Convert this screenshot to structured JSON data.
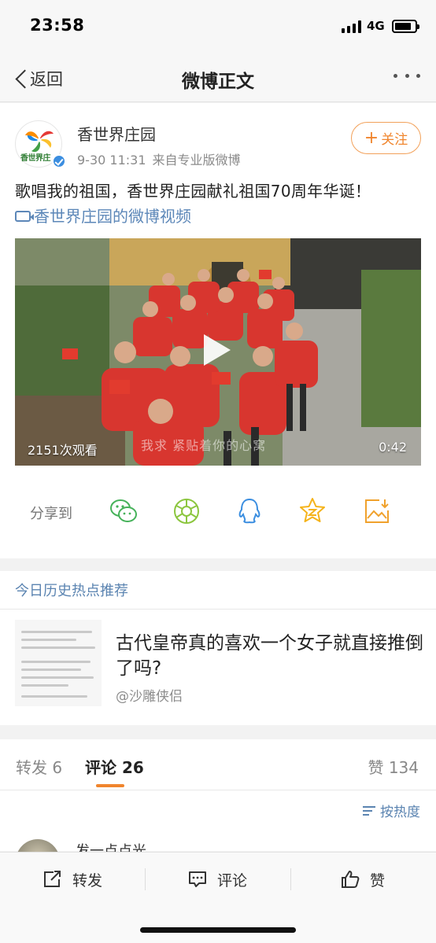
{
  "status": {
    "time": "23:58",
    "network": "4G",
    "battery_level": 0.85
  },
  "nav": {
    "back_label": "返回",
    "title": "微博正文"
  },
  "post": {
    "author": "香世界庄园",
    "avatar_text": "香世界庄",
    "timestamp": "9-30 11:31",
    "source": "来自专业版微博",
    "follow_label": "关注",
    "text": "歌唱我的祖国，香世界庄园献礼祖国70周年华诞！",
    "video_link": "香世界庄园的微博视频",
    "video": {
      "views": "2151次观看",
      "duration": "0:42",
      "subtitle": "我求 紧贴着你的心窝"
    }
  },
  "share": {
    "label": "分享到",
    "targets": [
      "wechat-icon",
      "moments-icon",
      "qq-icon",
      "qzone-icon",
      "save-image-icon"
    ],
    "colors": {
      "wechat": "#46b25a",
      "moments": "#8cc63f",
      "qq": "#3b8ee0",
      "qzone": "#f5b31a",
      "save": "#f0a12c"
    }
  },
  "hot": {
    "title": "今日历史热点推荐",
    "headline": "古代皇帝真的喜欢一个女子就直接推倒了吗?",
    "author": "@沙雕侠侣"
  },
  "tabs": {
    "repost": "转发 6",
    "comment": "评论 26",
    "like": "赞 134",
    "sort": "按热度"
  },
  "comments": [
    {
      "user": "发一点点光"
    }
  ],
  "bottom": {
    "repost": "转发",
    "comment": "评论",
    "like": "赞"
  },
  "colors": {
    "accent": "#f0852d",
    "link": "#5b84b1",
    "video_link": "#5c87b8"
  }
}
